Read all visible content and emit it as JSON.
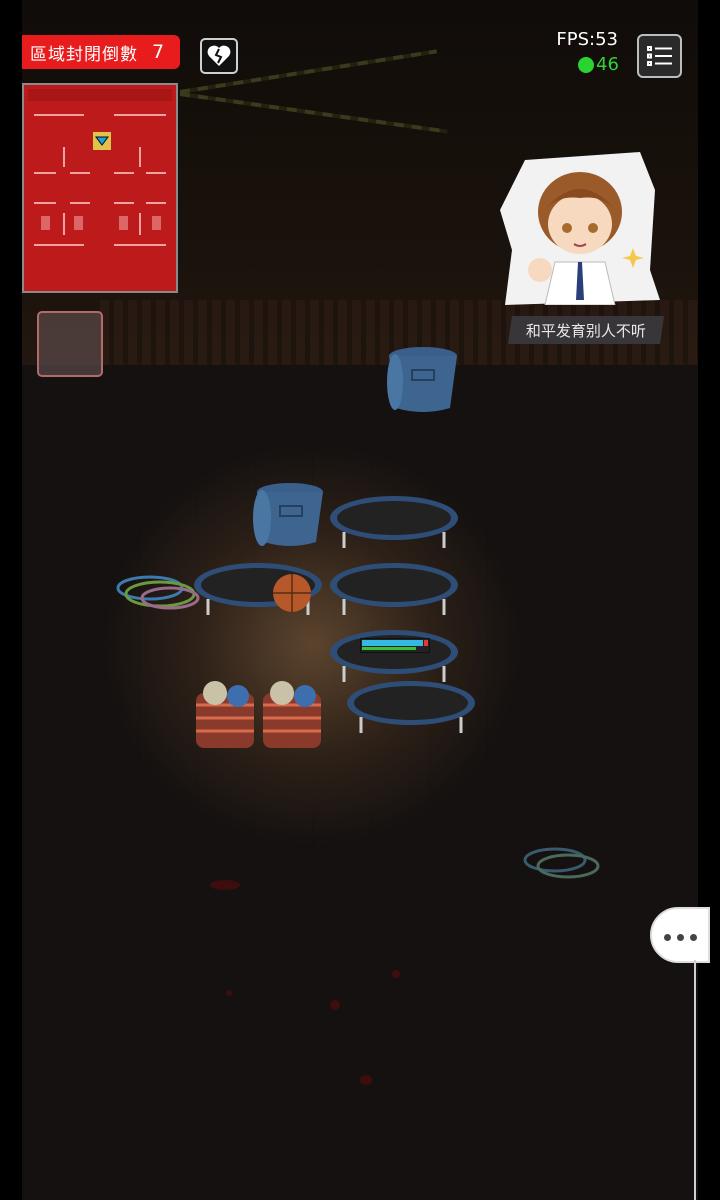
{
  "hud": {
    "countdown_label": "區域封閉倒數",
    "countdown_value": "7",
    "fps": "FPS:53",
    "ping": "46",
    "icons": [
      "broken-heart-icon",
      "menu-list-icon"
    ]
  },
  "character": {
    "speech": "和平发育别人不听"
  },
  "colors": {
    "alert_red": "#e81c1c",
    "ping_green": "#2bd331",
    "minimap_red": "#bd1b1b"
  },
  "player": {
    "health_fraction": 0.92,
    "stamina_fraction": 0.82
  }
}
